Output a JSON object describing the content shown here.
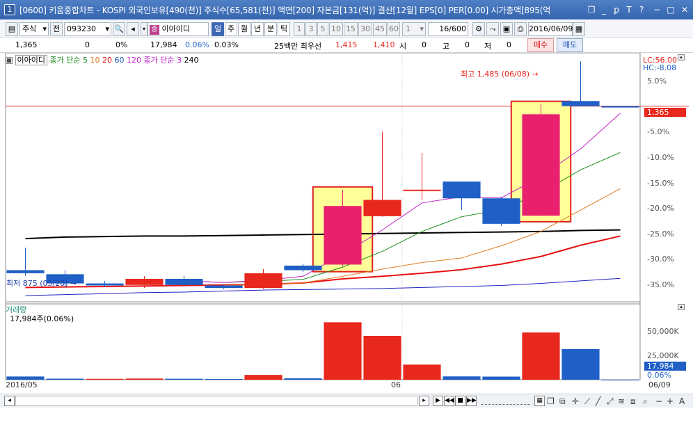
{
  "window": {
    "number": "1",
    "title": "[0600] 키움종합차트 - KOSPI 외국인보유[490(천)] 주식수[65,581(천)] 액면[200] 자본금[131(억)] 결산[12월] EPS[0] PER[0.00] 시가총액[895(억"
  },
  "toolbar": {
    "market": "주식",
    "prev_label": "전",
    "code": "093230",
    "name": "이아이디",
    "period_tabs": [
      "일",
      "주",
      "월",
      "년",
      "분",
      "틱"
    ],
    "minute_options": [
      "1",
      "3",
      "5",
      "10",
      "15",
      "30",
      "45",
      "60"
    ],
    "interval": "1",
    "count": "16",
    "count_total": "/600",
    "date": "2016/06/09"
  },
  "quote": {
    "price": "1,365",
    "change": "0",
    "change_rate": "0%",
    "volume": "17,984",
    "volume_rate": "0.06%",
    "turnover": "0.03%",
    "best_label": "25백만  최우선",
    "ask": "1,415",
    "bid": "1,410",
    "open_label": "시",
    "open": "0",
    "high_label": "고",
    "high": "0",
    "low_label": "저",
    "low": "0",
    "buy_label": "매수",
    "sell_label": "매도"
  },
  "legend": {
    "stock": "이아이디",
    "ma_label": "종가 단순",
    "ma5": "5",
    "ma10": "10",
    "ma20": "20",
    "ma60": "60",
    "ma120": "120",
    "ma2_label": "종가 단순 3",
    "ma240": "240"
  },
  "annotations": {
    "high_label": "최고 1,485 (06/08)",
    "high_arrow": "→",
    "low_label": "최저 875 (05/20)",
    "low_arrow": "→"
  },
  "right_axis": {
    "lc": "LC:56.00",
    "hc": "HC:-8.08",
    "price_ticks": [
      "5.0%",
      "0.00%",
      "-5.0%",
      "-10.0%",
      "-15.0%",
      "-20.0%",
      "-25.0%",
      "-30.0%",
      "-35.0%"
    ],
    "price_ticks_v": [
      5,
      0,
      -5,
      -10,
      -15,
      -20,
      -25,
      -30,
      -35
    ],
    "current_price_tag": "1,365",
    "volume_ticks": [
      "50,000K",
      "25,000K"
    ],
    "volume_ticks_v": [
      50000,
      25000
    ],
    "current_volume_tag": "17,984",
    "volume_rate": "0.06%"
  },
  "volume_panel": {
    "title": "거래량",
    "value": "17,984주(0.06%)"
  },
  "x_axis": {
    "start": "2016/05",
    "mid": "06",
    "end": "06/09"
  },
  "colors": {
    "up": "#e8271d",
    "down": "#1f5fc6",
    "ma5": "#c020c8",
    "ma10": "#1a8a1a",
    "ma20": "#e07a20",
    "ma60": "#e81010",
    "ma120": "#2020c0",
    "ma240": "#000000",
    "highlight_fill": "#ffff99",
    "highlight_border": "#e02020",
    "candle_pink": "#e8206e"
  },
  "chart_data": {
    "type": "candlestick",
    "y_unit": "% from reference",
    "ylim": [
      -38,
      8
    ],
    "candles": [
      {
        "open": -32.2,
        "close": -32.8,
        "high": -27.8,
        "low": -33.3
      },
      {
        "open": -33.0,
        "close": -34.8,
        "high": -32.2,
        "low": -35.4
      },
      {
        "open": -34.8,
        "close": -35.2,
        "high": -34.3,
        "low": -35.5
      },
      {
        "open": -35.1,
        "close": -33.9,
        "high": -33.4,
        "low": -35.7
      },
      {
        "open": -33.9,
        "close": -35.1,
        "high": -33.3,
        "low": -35.4
      },
      {
        "open": -35.2,
        "close": -35.7,
        "high": -35.0,
        "low": -35.9
      },
      {
        "open": -35.7,
        "close": -32.8,
        "high": -32.0,
        "low": -35.9
      },
      {
        "open": -31.3,
        "close": -32.2,
        "high": -31.0,
        "low": -32.6
      },
      {
        "open": -31.1,
        "close": -19.6,
        "high": -16.4,
        "low": -31.4
      },
      {
        "open": -21.6,
        "close": -18.4,
        "high": -5.0,
        "low": -21.7
      },
      {
        "open": -16.4,
        "close": -16.4,
        "high": -9.2,
        "low": -18.4
      },
      {
        "open": -14.8,
        "close": -18.1,
        "high": -14.8,
        "low": -20.4
      },
      {
        "open": -18.1,
        "close": -23.1,
        "high": -17.8,
        "low": -23.5
      },
      {
        "open": -21.5,
        "close": -1.6,
        "high": 0.4,
        "low": -21.6
      },
      {
        "open": 1.0,
        "close": 0.0,
        "high": 8.8,
        "low": 0.0
      },
      {
        "open": 0.0,
        "close": 0.0,
        "high": 0.0,
        "low": 0.0
      }
    ],
    "candle_colors": [
      "down",
      "down",
      "down",
      "up",
      "down",
      "down",
      "up",
      "down",
      "pink",
      "up",
      "up",
      "down",
      "down",
      "pink",
      "down",
      "down"
    ],
    "volumes": [
      3300,
      1100,
      900,
      1200,
      1000,
      800,
      4900,
      1400,
      59000,
      45000,
      15500,
      3400,
      3200,
      48500,
      31500,
      18
    ],
    "volume_colors": [
      "down",
      "down",
      "up",
      "up",
      "down",
      "down",
      "up",
      "down",
      "up",
      "up",
      "up",
      "down",
      "down",
      "up",
      "down",
      "down"
    ],
    "volume_ylim": [
      0,
      70000
    ],
    "highlights": [
      8,
      13
    ],
    "ma240_y": [
      -26.0,
      -25.7,
      -25.6,
      -25.5,
      -25.5,
      -25.4,
      -25.3,
      -25.2,
      -25.1,
      -25.0,
      -24.9,
      -24.8,
      -24.7,
      -24.6,
      -24.4,
      -24.3
    ],
    "ma120_y": [
      -37.2,
      -37.0,
      -36.8,
      -36.6,
      -36.5,
      -36.3,
      -36.1,
      -36.0,
      -35.9,
      -35.8,
      -35.6,
      -35.4,
      -35.2,
      -34.8,
      -34.3,
      -33.8
    ],
    "ma60_y": [
      -35.6,
      -35.5,
      -35.4,
      -35.3,
      -35.2,
      -35.1,
      -35.0,
      -34.7,
      -33.9,
      -33.4,
      -32.8,
      -32.1,
      -31.0,
      -29.5,
      -27.3,
      -25.5
    ],
    "ma20_y": [
      null,
      null,
      null,
      null,
      null,
      -35.2,
      -35.0,
      -34.7,
      -33.4,
      -32.0,
      -30.7,
      -29.8,
      -27.4,
      -24.6,
      -20.4,
      -16.2
    ],
    "ma10_y": [
      null,
      null,
      null,
      null,
      -34.3,
      -34.6,
      -34.4,
      -34.0,
      -31.6,
      -28.5,
      -24.6,
      -21.7,
      -20.3,
      -17.0,
      -12.5,
      -9.1
    ],
    "ma5_y": [
      null,
      null,
      null,
      null,
      -34.3,
      -34.6,
      -34.2,
      -33.4,
      -29.1,
      -24.3,
      -19.0,
      -17.8,
      -18.0,
      -13.8,
      -8.4,
      -1.4
    ]
  }
}
